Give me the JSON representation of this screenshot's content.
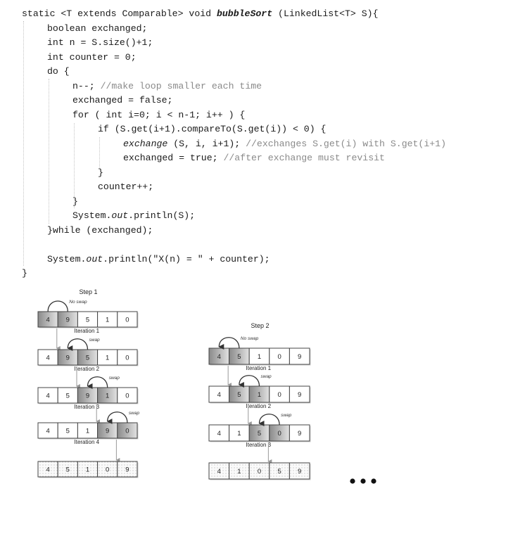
{
  "code": {
    "lines": [
      {
        "indent": 0,
        "tokens": [
          {
            "t": "static <T extends Comparable> void ",
            "s": "n"
          },
          {
            "t": "bubbleSort",
            "s": "bi"
          },
          {
            "t": " (LinkedList<T> S){",
            "s": "n"
          }
        ]
      },
      {
        "indent": 1,
        "tokens": [
          {
            "t": "boolean exchanged;",
            "s": "n"
          }
        ]
      },
      {
        "indent": 1,
        "tokens": [
          {
            "t": "int n = S.size()+1;",
            "s": "n"
          }
        ]
      },
      {
        "indent": 1,
        "tokens": [
          {
            "t": "int counter = 0;",
            "s": "n"
          }
        ]
      },
      {
        "indent": 1,
        "tokens": [
          {
            "t": "do {",
            "s": "n"
          }
        ]
      },
      {
        "indent": 2,
        "tokens": [
          {
            "t": "n--; ",
            "s": "n"
          },
          {
            "t": "//make loop smaller each time",
            "s": "cm"
          }
        ]
      },
      {
        "indent": 2,
        "tokens": [
          {
            "t": "exchanged = false;",
            "s": "n"
          }
        ]
      },
      {
        "indent": 2,
        "tokens": [
          {
            "t": "for ( int i=0; i < n-1; i++ ) {",
            "s": "n"
          }
        ]
      },
      {
        "indent": 3,
        "tokens": [
          {
            "t": "if (S.get(i+1).compareTo(S.get(i)) < 0) {",
            "s": "n"
          }
        ]
      },
      {
        "indent": 4,
        "tokens": [
          {
            "t": "exchange",
            "s": "it"
          },
          {
            "t": " (S, i, i+1); ",
            "s": "n"
          },
          {
            "t": "//exchanges S.get(i) with S.get(i+1)",
            "s": "cm"
          }
        ]
      },
      {
        "indent": 4,
        "tokens": [
          {
            "t": "exchanged = true; ",
            "s": "n"
          },
          {
            "t": "//after exchange must revisit",
            "s": "cm"
          }
        ]
      },
      {
        "indent": 3,
        "tokens": [
          {
            "t": "}",
            "s": "n"
          }
        ]
      },
      {
        "indent": 3,
        "tokens": [
          {
            "t": "counter++;",
            "s": "n"
          }
        ]
      },
      {
        "indent": 2,
        "tokens": [
          {
            "t": "}",
            "s": "n"
          }
        ]
      },
      {
        "indent": 2,
        "tokens": [
          {
            "t": "System.",
            "s": "n"
          },
          {
            "t": "out",
            "s": "it"
          },
          {
            "t": ".println(S);",
            "s": "n"
          }
        ]
      },
      {
        "indent": 1,
        "tokens": [
          {
            "t": "}while (exchanged);",
            "s": "n"
          }
        ]
      },
      {
        "indent": 1,
        "tokens": []
      },
      {
        "indent": 1,
        "tokens": [
          {
            "t": "System.",
            "s": "n"
          },
          {
            "t": "out",
            "s": "it"
          },
          {
            "t": ".println(\"X(n) = \" + counter);",
            "s": "n"
          }
        ]
      },
      {
        "indent": 0,
        "tokens": [
          {
            "t": "}",
            "s": "n"
          }
        ]
      }
    ]
  },
  "diagram": {
    "colors": {
      "highlight_dark": "#8f8f8f",
      "highlight_light": "#e4e4e4",
      "border": "#444444",
      "arrow": "#999999",
      "swap_arc": "#333333",
      "dots": "#111111"
    },
    "steps": [
      {
        "title": "Step 1",
        "rows": [
          {
            "values": [
              "4",
              "9",
              "5",
              "1",
              "0"
            ],
            "highlight": [
              0,
              1
            ],
            "action": "No swap",
            "arc_dir": "right",
            "label_below": "Iteration 1"
          },
          {
            "values": [
              "4",
              "9",
              "5",
              "1",
              "0"
            ],
            "highlight": [
              1,
              2
            ],
            "action": "swap",
            "arc_dir": "left",
            "label_below": "Iteration 2"
          },
          {
            "values": [
              "4",
              "5",
              "9",
              "1",
              "0"
            ],
            "highlight": [
              2,
              3
            ],
            "action": "swap",
            "arc_dir": "left",
            "label_below": "Iteration 3"
          },
          {
            "values": [
              "4",
              "5",
              "1",
              "9",
              "0"
            ],
            "highlight": [
              3,
              4
            ],
            "action": "swap",
            "arc_dir": "left",
            "label_below": "Iteration 4"
          },
          {
            "values": [
              "4",
              "5",
              "1",
              "0",
              "9"
            ],
            "highlight": [],
            "dotted": true,
            "action": "",
            "label_below": ""
          }
        ]
      },
      {
        "title": "Step 2",
        "rows": [
          {
            "values": [
              "4",
              "5",
              "1",
              "0",
              "9"
            ],
            "highlight": [
              0,
              1
            ],
            "action": "No swap",
            "arc_dir": "left",
            "label_below": "Iteration 1"
          },
          {
            "values": [
              "4",
              "5",
              "1",
              "0",
              "9"
            ],
            "highlight": [
              1,
              2
            ],
            "action": "swap",
            "arc_dir": "left",
            "label_below": "Iteration 2"
          },
          {
            "values": [
              "4",
              "1",
              "5",
              "0",
              "9"
            ],
            "highlight": [
              2,
              3
            ],
            "action": "swap",
            "arc_dir": "left",
            "label_below": "Iteration 3"
          },
          {
            "values": [
              "4",
              "1",
              "0",
              "5",
              "9"
            ],
            "highlight": [],
            "dotted": true,
            "action": "",
            "label_below": ""
          }
        ]
      }
    ],
    "continuation": "..."
  }
}
